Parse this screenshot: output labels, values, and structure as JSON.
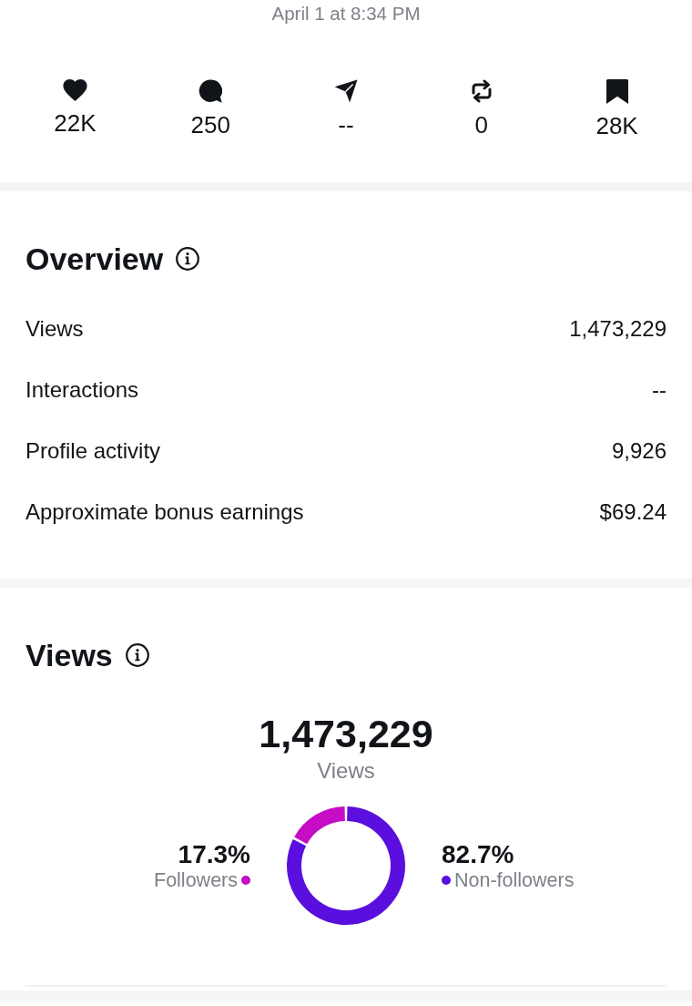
{
  "timestamp": "April 1 at 8:34 PM",
  "stats": [
    {
      "kind": "like",
      "value": "22K"
    },
    {
      "kind": "comment",
      "value": "250"
    },
    {
      "kind": "share",
      "value": "--"
    },
    {
      "kind": "repost",
      "value": "0"
    },
    {
      "kind": "save",
      "value": "28K"
    }
  ],
  "overview": {
    "title": "Overview",
    "metrics": [
      {
        "label": "Views",
        "value": "1,473,229"
      },
      {
        "label": "Interactions",
        "value": "--"
      },
      {
        "label": "Profile activity",
        "value": "9,926"
      },
      {
        "label": "Approximate bonus earnings",
        "value": "$69.24"
      }
    ]
  },
  "views": {
    "title": "Views",
    "total": "1,473,229",
    "total_label": "Views",
    "segments": [
      {
        "percent": "17.3%",
        "label": "Followers",
        "color": "#c40dc4"
      },
      {
        "percent": "82.7%",
        "label": "Non-followers",
        "color": "#5a0fdf"
      }
    ],
    "chart_data": {
      "type": "donut",
      "values": [
        17.3,
        82.7
      ]
    }
  }
}
